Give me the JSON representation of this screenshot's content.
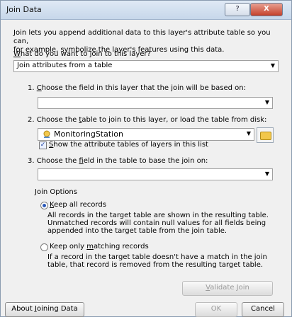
{
  "dialog": {
    "title": "Join Data",
    "help_label": "?",
    "close_label": "X",
    "intro_line1": "Join lets you append additional data to this layer's attribute table so you can,",
    "intro_line2": "for example, symbolize the layer's features using this data.",
    "question_prefix": "W",
    "question_rest": "hat do you want to join to this layer?",
    "join_type": "Join attributes from a table",
    "step1": {
      "num": "1.",
      "label_prefix": "C",
      "label_rest": "hoose the field in this layer that the join will be based on:",
      "value": ""
    },
    "step2": {
      "label_a": "2.  Choose the ",
      "label_u": "t",
      "label_b": "able to join to this layer, or load the table from disk:",
      "table_value": "MonitoringStation",
      "show_tables_prefix": "S",
      "show_tables_rest": "how the attribute tables of layers in this list"
    },
    "step3": {
      "label_a": "3.  Choose the ",
      "label_u": "f",
      "label_b": "ield in the table to base the join on:",
      "value": ""
    },
    "options": {
      "group_label": "Join Options",
      "keep_all_prefix": "K",
      "keep_all_rest": "eep all records",
      "keep_all_desc1": "All records in the target table are shown in the resulting table.",
      "keep_all_desc2": "Unmatched records will contain null values for all fields being",
      "keep_all_desc3": "appended into the target table from the join table.",
      "keep_only_a": "Keep only ",
      "keep_only_u": "m",
      "keep_only_b": "atching records",
      "keep_only_desc1": "If a record in the target table doesn't have a match in the join",
      "keep_only_desc2": "table, that record is removed from the resulting target table."
    },
    "buttons": {
      "validate_a": "V",
      "validate_b": "alidate Join",
      "about_a": "About ",
      "about_u": "J",
      "about_b": "oining Data",
      "ok": "OK",
      "cancel": "Cancel"
    }
  }
}
